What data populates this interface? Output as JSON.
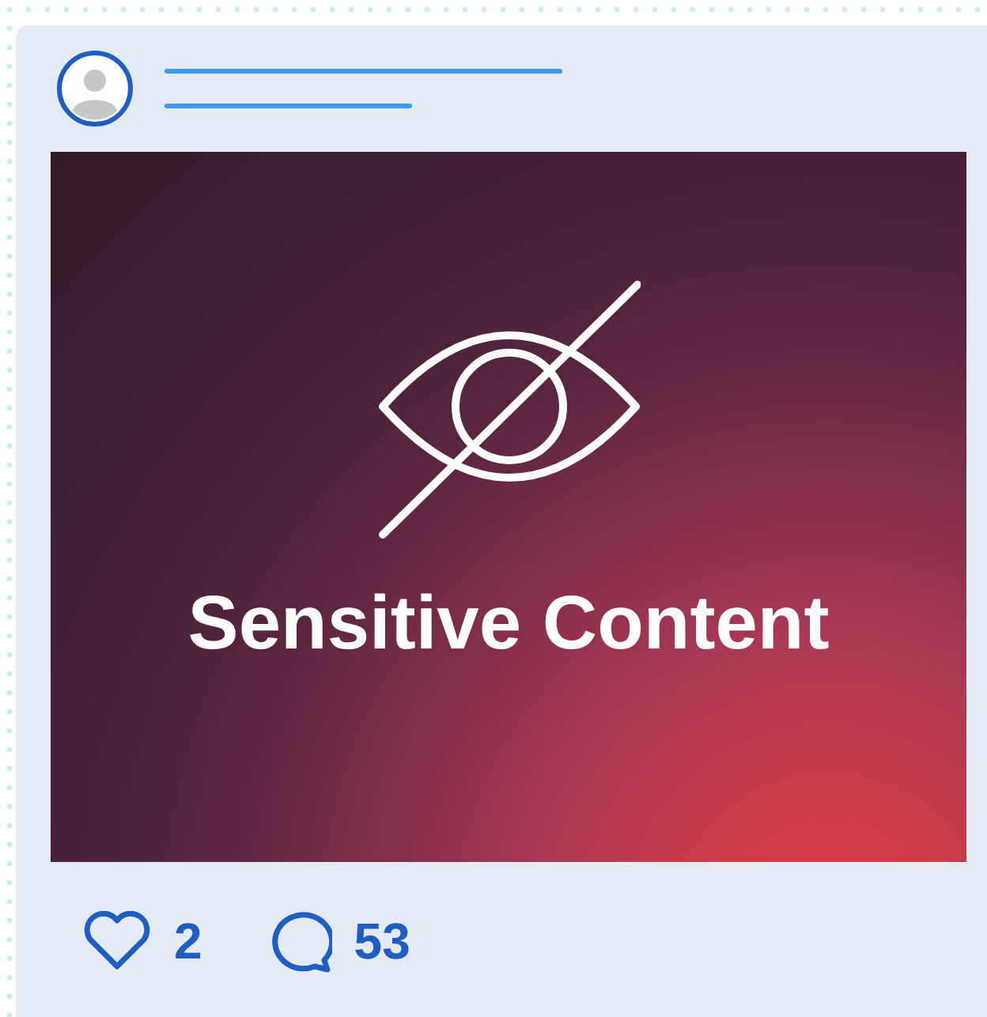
{
  "post": {
    "overlay_text": "Sensitive Content",
    "likes": "2",
    "comments": "53"
  }
}
